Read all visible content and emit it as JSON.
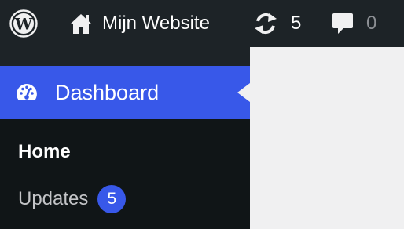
{
  "adminbar": {
    "wp_logo_icon": "wordpress-logo-icon",
    "home_icon": "home-icon",
    "site_name": "Mijn Website",
    "updates_icon": "refresh-icon",
    "updates_count": "5",
    "comments_icon": "comment-icon",
    "comments_count": "0"
  },
  "sidebar": {
    "dashboard": {
      "icon": "dashboard-gauge-icon",
      "label": "Dashboard"
    },
    "submenu": [
      {
        "label": "Home"
      },
      {
        "label": "Updates",
        "badge": "5"
      }
    ]
  },
  "colors": {
    "adminbar_bg": "#1d2327",
    "active_menu_bg": "#3858e9",
    "submenu_bg": "#101517",
    "content_bg": "#f0f0f1",
    "badge_bg": "#3858e9"
  }
}
